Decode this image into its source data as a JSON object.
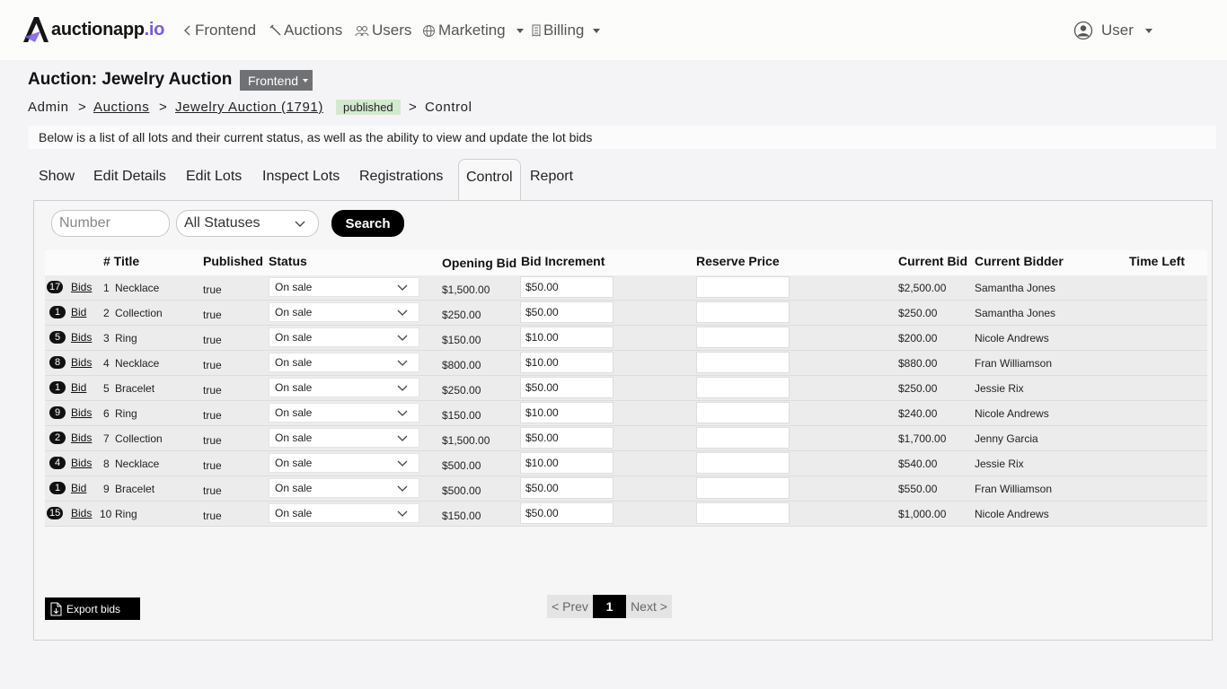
{
  "brand": {
    "name": "auctionapp",
    "suffix": ".io"
  },
  "nav": {
    "frontend": "Frontend",
    "auctions": "Auctions",
    "users": "Users",
    "marketing": "Marketing",
    "billing": "Billing",
    "user": "User"
  },
  "page": {
    "title": "Auction: Jewelry Auction",
    "view_select": "Frontend",
    "intro": "Below is a list of all lots and their current status, as well as the ability to view and update the lot bids"
  },
  "breadcrumb": {
    "admin": "Admin",
    "sep": ">",
    "auctions": "Auctions",
    "auction": "Jewelry Auction (1791)",
    "status_badge": "published",
    "current": "Control"
  },
  "tabs": [
    "Show",
    "Edit Details",
    "Edit Lots",
    "Inspect Lots",
    "Registrations",
    "Control",
    "Report"
  ],
  "active_tab": "Control",
  "filters": {
    "number_placeholder": "Number",
    "status_value": "All Statuses",
    "search_label": "Search"
  },
  "table": {
    "headers": {
      "num_title": "# Title",
      "published": "Published",
      "status": "Status",
      "opening_bid": "Opening Bid",
      "bid_increment": "Bid Increment",
      "reserve_price": "Reserve Price",
      "current_bid": "Current Bid",
      "current_bidder": "Current Bidder",
      "time_left": "Time Left"
    },
    "rows": [
      {
        "count": "17",
        "bids_label": "Bids",
        "num": "1",
        "title": "Necklace",
        "published": "true",
        "status": "On sale",
        "opening_bid": "$1,500.00",
        "increment": "$50.00",
        "reserve": "",
        "current_bid": "$2,500.00",
        "bidder": "Samantha Jones"
      },
      {
        "count": "1",
        "bids_label": "Bid",
        "num": "2",
        "title": "Collection",
        "published": "true",
        "status": "On sale",
        "opening_bid": "$250.00",
        "increment": "$50.00",
        "reserve": "",
        "current_bid": "$250.00",
        "bidder": "Samantha Jones"
      },
      {
        "count": "5",
        "bids_label": "Bids",
        "num": "3",
        "title": "Ring",
        "published": "true",
        "status": "On sale",
        "opening_bid": "$150.00",
        "increment": "$10.00",
        "reserve": "",
        "current_bid": "$200.00",
        "bidder": "Nicole Andrews"
      },
      {
        "count": "8",
        "bids_label": "Bids",
        "num": "4",
        "title": "Necklace",
        "published": "true",
        "status": "On sale",
        "opening_bid": "$800.00",
        "increment": "$10.00",
        "reserve": "",
        "current_bid": "$880.00",
        "bidder": "Fran Williamson"
      },
      {
        "count": "1",
        "bids_label": "Bid",
        "num": "5",
        "title": "Bracelet",
        "published": "true",
        "status": "On sale",
        "opening_bid": "$250.00",
        "increment": "$50.00",
        "reserve": "",
        "current_bid": "$250.00",
        "bidder": "Jessie Rix"
      },
      {
        "count": "9",
        "bids_label": "Bids",
        "num": "6",
        "title": "Ring",
        "published": "true",
        "status": "On sale",
        "opening_bid": "$150.00",
        "increment": "$10.00",
        "reserve": "",
        "current_bid": "$240.00",
        "bidder": "Nicole Andrews"
      },
      {
        "count": "2",
        "bids_label": "Bids",
        "num": "7",
        "title": "Collection",
        "published": "true",
        "status": "On sale",
        "opening_bid": "$1,500.00",
        "increment": "$50.00",
        "reserve": "",
        "current_bid": "$1,700.00",
        "bidder": "Jenny Garcia"
      },
      {
        "count": "4",
        "bids_label": "Bids",
        "num": "8",
        "title": "Necklace",
        "published": "true",
        "status": "On sale",
        "opening_bid": "$500.00",
        "increment": "$10.00",
        "reserve": "",
        "current_bid": "$540.00",
        "bidder": "Jessie Rix"
      },
      {
        "count": "1",
        "bids_label": "Bid",
        "num": "9",
        "title": "Bracelet",
        "published": "true",
        "status": "On sale",
        "opening_bid": "$500.00",
        "increment": "$50.00",
        "reserve": "",
        "current_bid": "$550.00",
        "bidder": "Fran Williamson"
      },
      {
        "count": "15",
        "bids_label": "Bids",
        "num": "10",
        "title": "Ring",
        "published": "true",
        "status": "On sale",
        "opening_bid": "$150.00",
        "increment": "$50.00",
        "reserve": "",
        "current_bid": "$1,000.00",
        "bidder": "Nicole Andrews"
      }
    ]
  },
  "footer": {
    "export_label": "Export bids",
    "prev_label": "< Prev",
    "current_page": "1",
    "next_label": "Next >"
  },
  "colors": {
    "brand_accent": "#7a5ae0",
    "published_badge": "#d3e9cf",
    "primary_button": "#000000"
  }
}
